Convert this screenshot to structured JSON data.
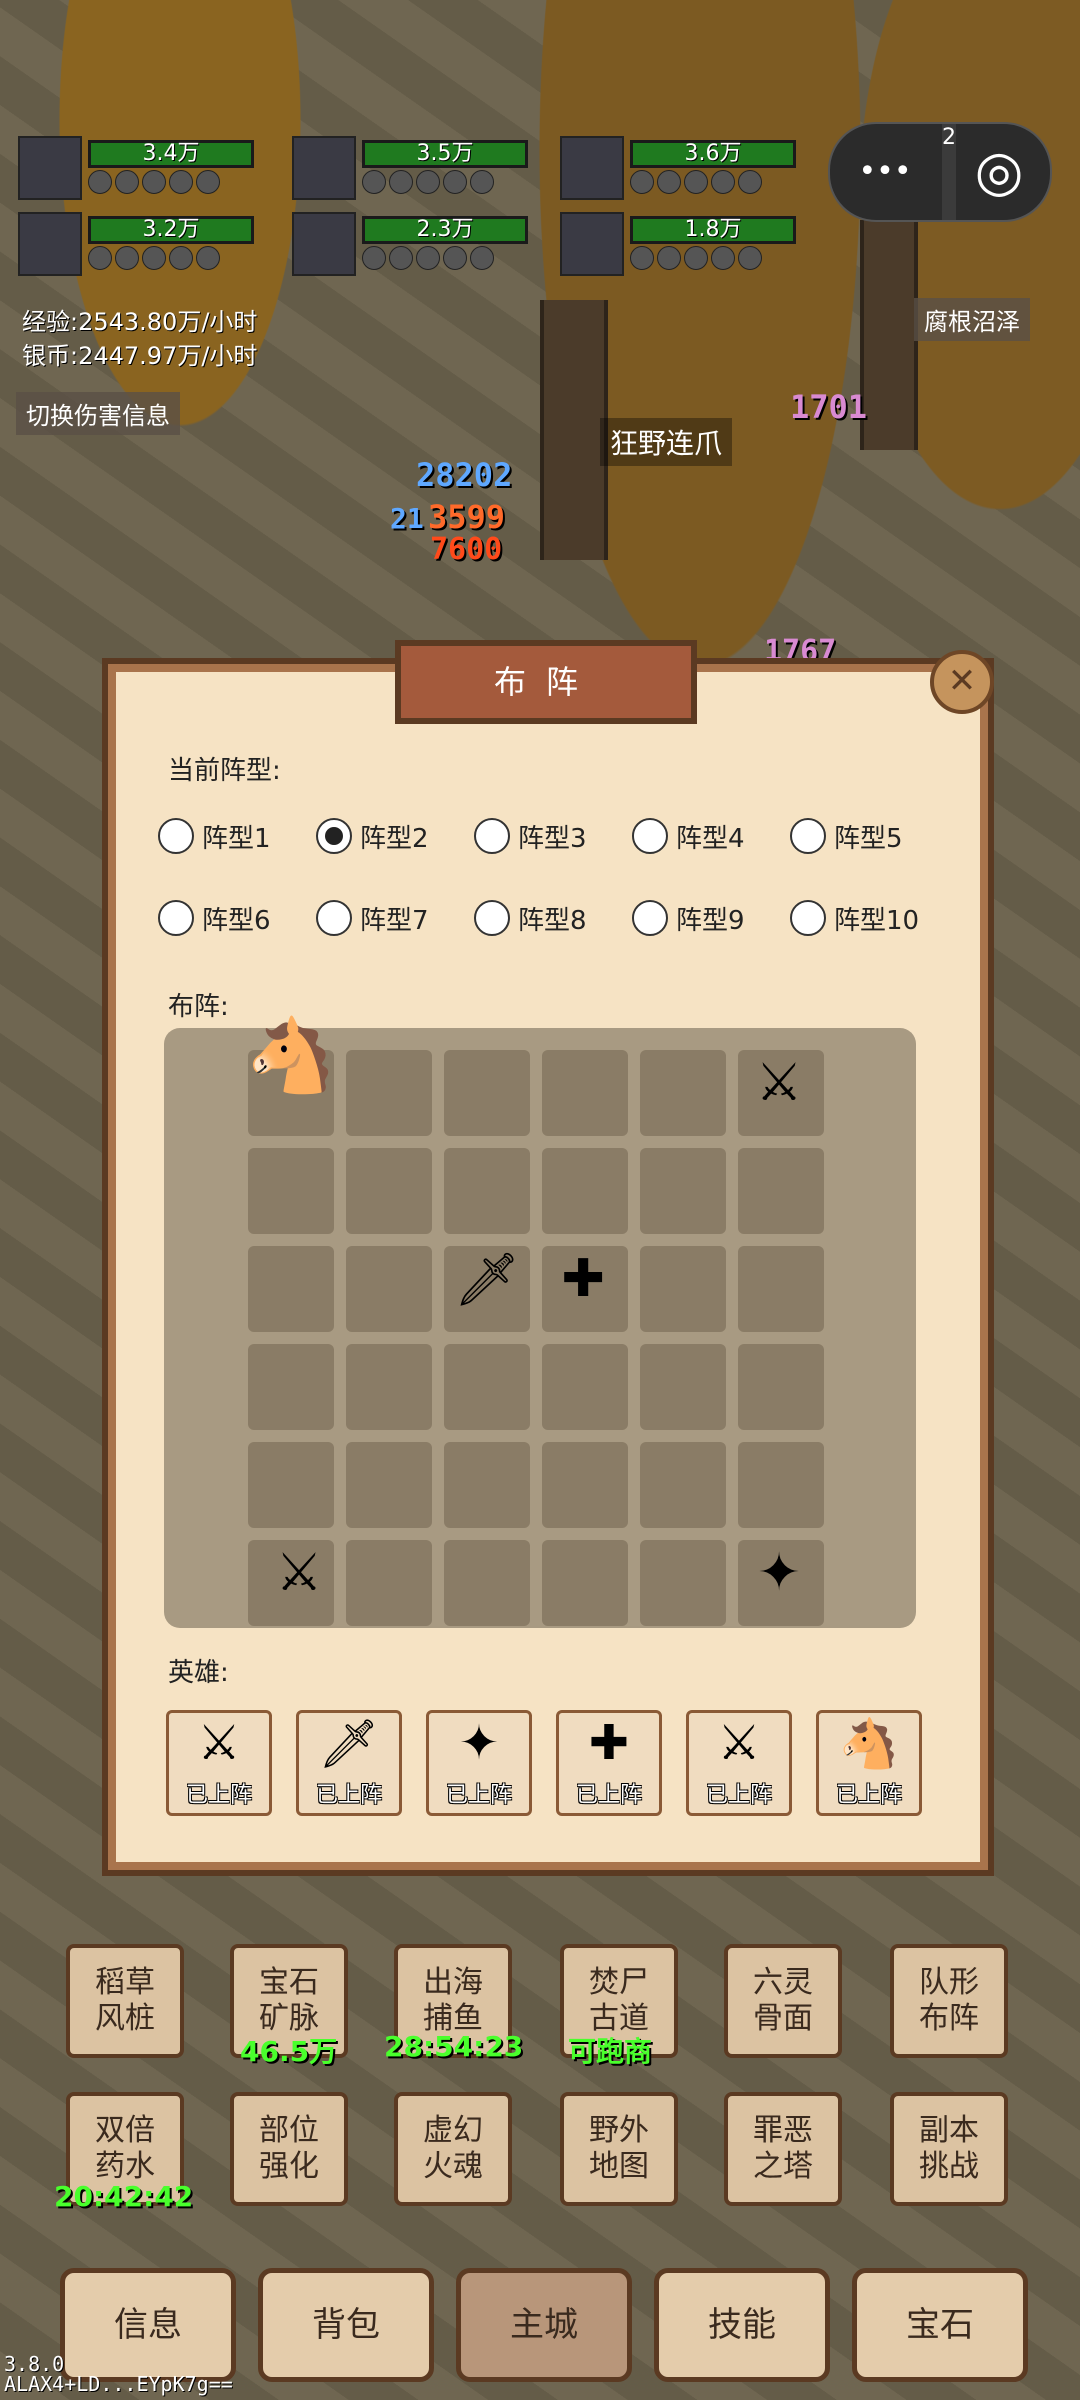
{
  "party": [
    {
      "power": "3.4万"
    },
    {
      "power": "3.5万"
    },
    {
      "power": "3.6万"
    },
    {
      "power": "3.2万"
    },
    {
      "power": "2.3万"
    },
    {
      "power": "1.8万"
    },
    {
      "power": "2"
    }
  ],
  "stats": {
    "exp": "经验:2543.80万/小时",
    "silver": "银币:2447.97万/小时",
    "switch_damage": "切换伤害信息",
    "location": "腐根沼泽"
  },
  "battle": {
    "skill_name": "狂野连爪",
    "dmg1": "1701",
    "dmg2": "28202",
    "dmg3": "3599",
    "dmg4": "7600",
    "dmg5": "1767",
    "dmg6": "21"
  },
  "capsule": {
    "more": "•••",
    "close": "◎"
  },
  "dialog": {
    "title": "布阵",
    "current_formation_label": "当前阵型:",
    "formations": [
      "阵型1",
      "阵型2",
      "阵型3",
      "阵型4",
      "阵型5",
      "阵型6",
      "阵型7",
      "阵型8",
      "阵型9",
      "阵型10"
    ],
    "selected_formation": "阵型2",
    "layout_label": "布阵:",
    "heroes_label": "英雄:",
    "close_icon": "crossed-swords-icon",
    "hero_status": [
      "已上阵",
      "已上阵",
      "已上阵",
      "已上阵",
      "已上阵",
      "已上阵"
    ]
  },
  "functions": {
    "row1": [
      {
        "label": "稻草风桩",
        "sub": ""
      },
      {
        "label": "宝石矿脉",
        "sub": "46.5万"
      },
      {
        "label": "出海捕鱼",
        "sub": "28:54:23"
      },
      {
        "label": "焚尸古道",
        "sub": "可跑商"
      },
      {
        "label": "六灵骨面",
        "sub": ""
      },
      {
        "label": "队形布阵",
        "sub": ""
      }
    ],
    "row2": [
      {
        "label": "双倍药水",
        "sub": "20:42:42"
      },
      {
        "label": "部位强化",
        "sub": ""
      },
      {
        "label": "虚幻火魂",
        "sub": ""
      },
      {
        "label": "野外地图",
        "sub": ""
      },
      {
        "label": "罪恶之塔",
        "sub": ""
      },
      {
        "label": "副本挑战",
        "sub": ""
      }
    ]
  },
  "nav": [
    "信息",
    "背包",
    "主城",
    "技能",
    "宝石"
  ],
  "nav_active": "主城",
  "version": {
    "line1": "3.8.0",
    "line2": "ALAX4+LD...EYpK7g=="
  }
}
